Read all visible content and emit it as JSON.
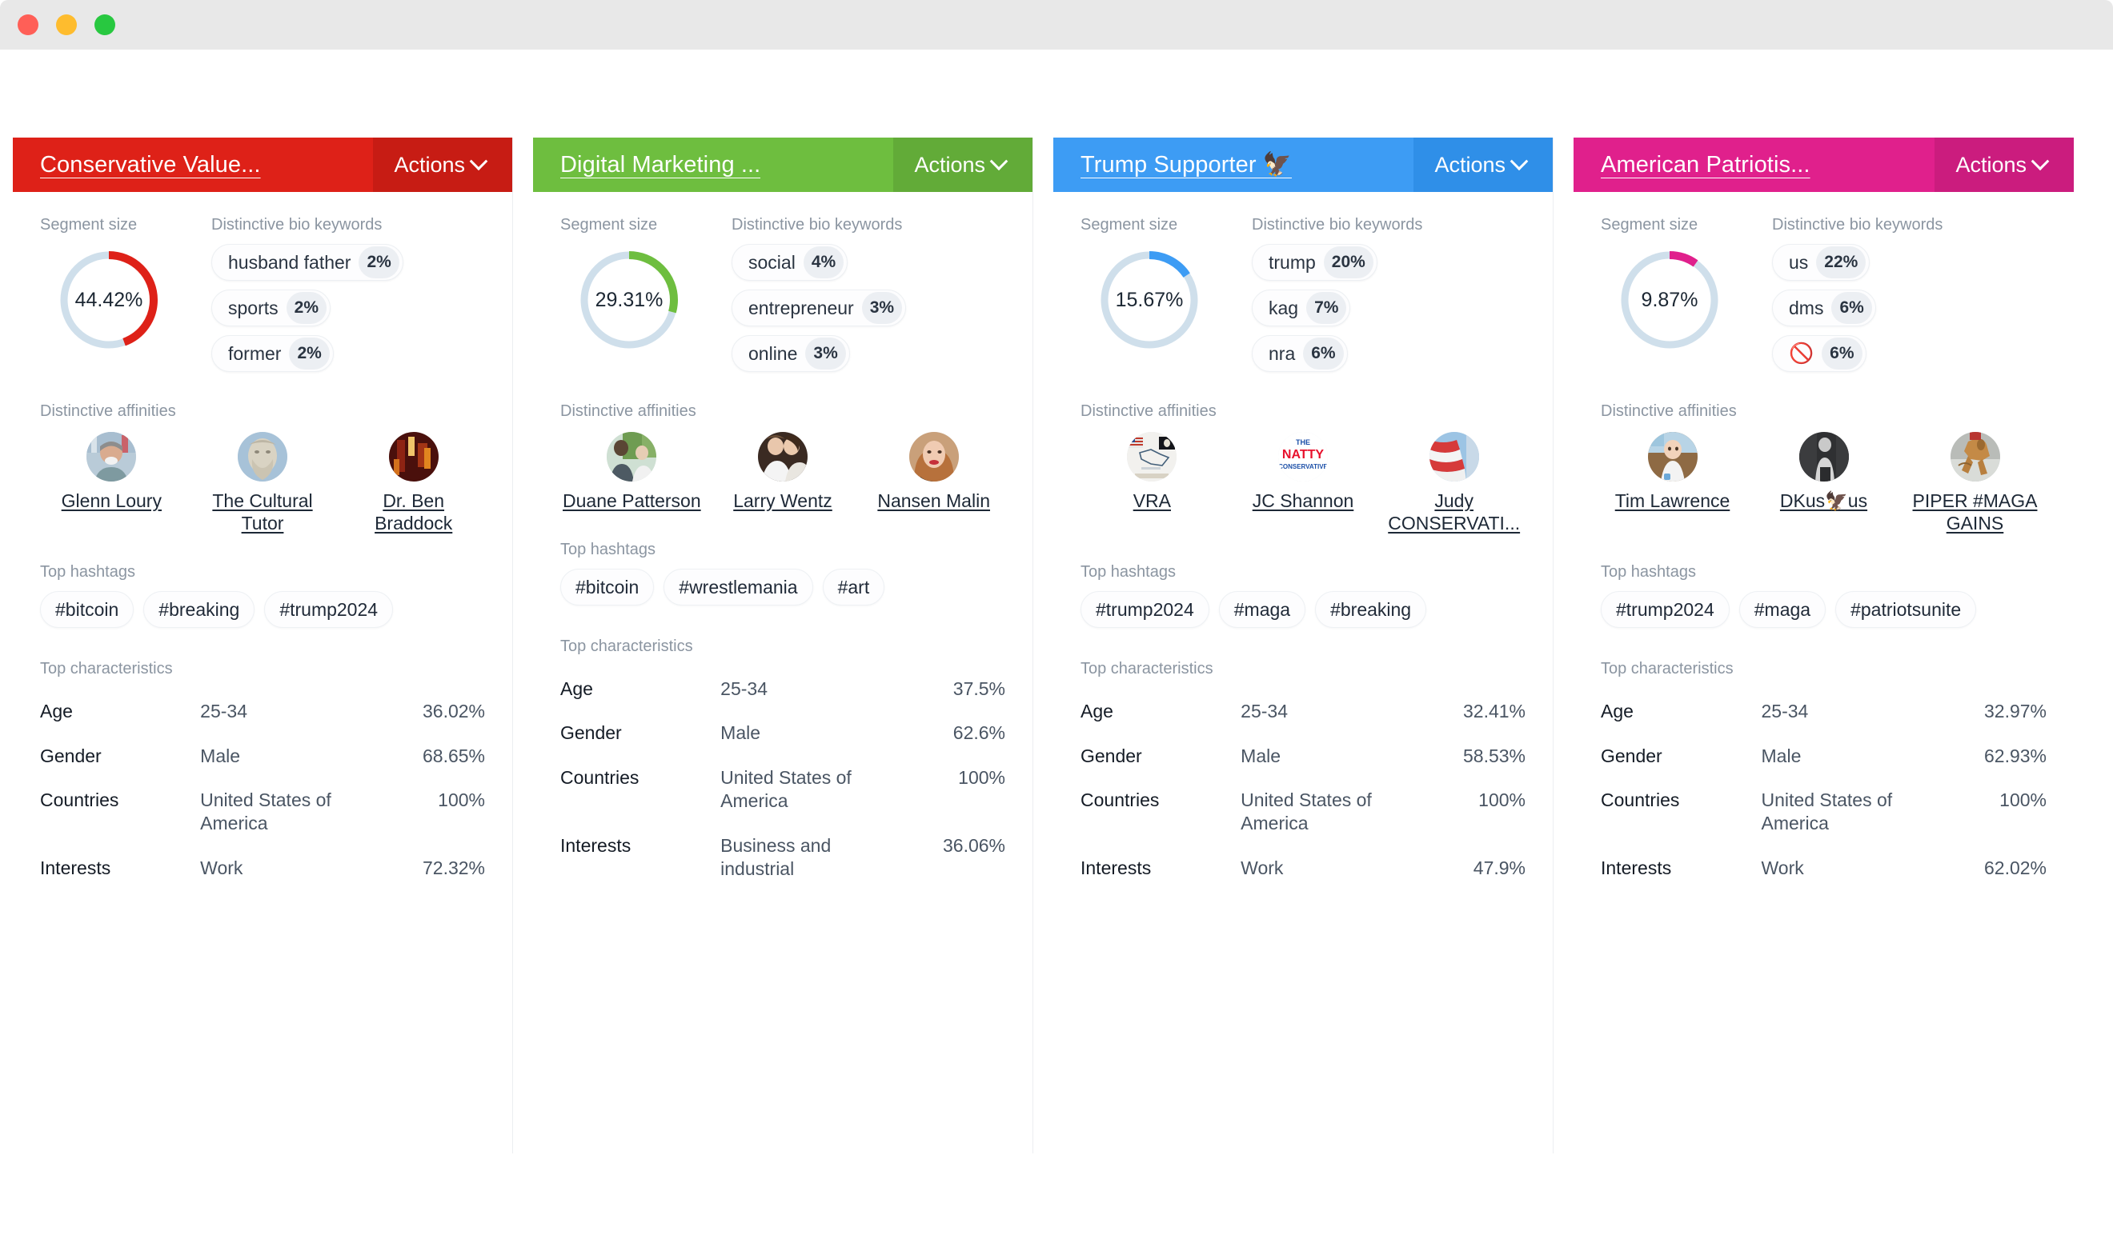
{
  "window": {
    "traffic_lights": [
      "close-button",
      "minimize-button",
      "zoom-button"
    ]
  },
  "labels": {
    "segment_size": "Segment size",
    "bio_keywords": "Distinctive bio keywords",
    "affinities": "Distinctive affinities",
    "hashtags": "Top hashtags",
    "characteristics": "Top characteristics",
    "actions": "Actions"
  },
  "colors": {
    "card1": "#de2118",
    "card1_dark": "#c71c14",
    "card2": "#6ebe3f",
    "card2_dark": "#62ab38",
    "card3": "#3d9cf4",
    "card3_dark": "#2f8fe8",
    "card4": "#e0208c",
    "card4_dark": "#cb1c7e",
    "track": "#cfdfeb"
  },
  "cards": [
    {
      "title": "Conservative Value...",
      "accent": "#de2118",
      "accent_dark": "#c71c14",
      "segment_size": "44.42%",
      "segment_value": 44.42,
      "keywords": [
        {
          "text": "husband father",
          "pct": "2%"
        },
        {
          "text": "sports",
          "pct": "2%"
        },
        {
          "text": "former",
          "pct": "2%"
        }
      ],
      "affinities": [
        {
          "name": "Glenn Loury",
          "avatar": "photo-man-glasses"
        },
        {
          "name": "The Cultural Tutor",
          "avatar": "photo-marble-bust"
        },
        {
          "name": "Dr. Ben Braddock",
          "avatar": "photo-dark-red"
        }
      ],
      "hashtags": [
        "#bitcoin",
        "#breaking",
        "#trump2024"
      ],
      "characteristics": [
        {
          "key": "Age",
          "value": "25-34",
          "pct": "36.02%"
        },
        {
          "key": "Gender",
          "value": "Male",
          "pct": "68.65%"
        },
        {
          "key": "Countries",
          "value": "United States of America",
          "pct": "100%"
        },
        {
          "key": "Interests",
          "value": "Work",
          "pct": "72.32%"
        }
      ]
    },
    {
      "title": "Digital Marketing ...",
      "accent": "#6ebe3f",
      "accent_dark": "#62ab38",
      "segment_size": "29.31%",
      "segment_value": 29.31,
      "keywords": [
        {
          "text": "social",
          "pct": "4%"
        },
        {
          "text": "entrepreneur",
          "pct": "3%"
        },
        {
          "text": "online",
          "pct": "3%"
        }
      ],
      "affinities": [
        {
          "name": "Duane Patterson",
          "avatar": "photo-outdoor-men"
        },
        {
          "name": "Larry Wentz",
          "avatar": "photo-couple"
        },
        {
          "name": "Nansen Malin",
          "avatar": "photo-woman-red-hair"
        }
      ],
      "hashtags": [
        "#bitcoin",
        "#wrestlemania",
        "#art"
      ],
      "characteristics": [
        {
          "key": "Age",
          "value": "25-34",
          "pct": "37.5%"
        },
        {
          "key": "Gender",
          "value": "Male",
          "pct": "62.6%"
        },
        {
          "key": "Countries",
          "value": "United States of America",
          "pct": "100%"
        },
        {
          "key": "Interests",
          "value": "Business and industrial",
          "pct": "36.06%"
        }
      ]
    },
    {
      "title": "Trump Supporter 🦅",
      "accent": "#3d9cf4",
      "accent_dark": "#2f8fe8",
      "segment_size": "15.67%",
      "segment_value": 15.67,
      "keywords": [
        {
          "text": "trump",
          "pct": "20%"
        },
        {
          "text": "kag",
          "pct": "7%"
        },
        {
          "text": "nra",
          "pct": "6%"
        }
      ],
      "affinities": [
        {
          "name": "VRA",
          "avatar": "photo-virginia-flag-map"
        },
        {
          "name": "JC Shannon",
          "avatar": "logo-the-natty-conservative"
        },
        {
          "name": "Judy CONSERVATI...",
          "avatar": "photo-us-flag"
        }
      ],
      "hashtags": [
        "#trump2024",
        "#maga",
        "#breaking"
      ],
      "characteristics": [
        {
          "key": "Age",
          "value": "25-34",
          "pct": "32.41%"
        },
        {
          "key": "Gender",
          "value": "Male",
          "pct": "58.53%"
        },
        {
          "key": "Countries",
          "value": "United States of America",
          "pct": "100%"
        },
        {
          "key": "Interests",
          "value": "Work",
          "pct": "47.9%"
        }
      ]
    },
    {
      "title": "American Patriotis...",
      "accent": "#e0208c",
      "accent_dark": "#cb1c7e",
      "segment_size": "9.87%",
      "segment_value": 9.87,
      "keywords": [
        {
          "text": "us",
          "pct": "22%"
        },
        {
          "text": "dms",
          "pct": "6%"
        },
        {
          "text": "🚫",
          "pct": "6%",
          "is_emoji": true
        }
      ],
      "affinities": [
        {
          "name": "Tim Lawrence",
          "avatar": "photo-toddler"
        },
        {
          "name": "DKus🦅us",
          "avatar": "photo-grayscale-child"
        },
        {
          "name": "PIPER #MAGA GAINS",
          "avatar": "photo-dog"
        }
      ],
      "hashtags": [
        "#trump2024",
        "#maga",
        "#patriotsunite"
      ],
      "characteristics": [
        {
          "key": "Age",
          "value": "25-34",
          "pct": "32.97%"
        },
        {
          "key": "Gender",
          "value": "Male",
          "pct": "62.93%"
        },
        {
          "key": "Countries",
          "value": "United States of America",
          "pct": "100%"
        },
        {
          "key": "Interests",
          "value": "Work",
          "pct": "62.02%"
        }
      ]
    }
  ]
}
